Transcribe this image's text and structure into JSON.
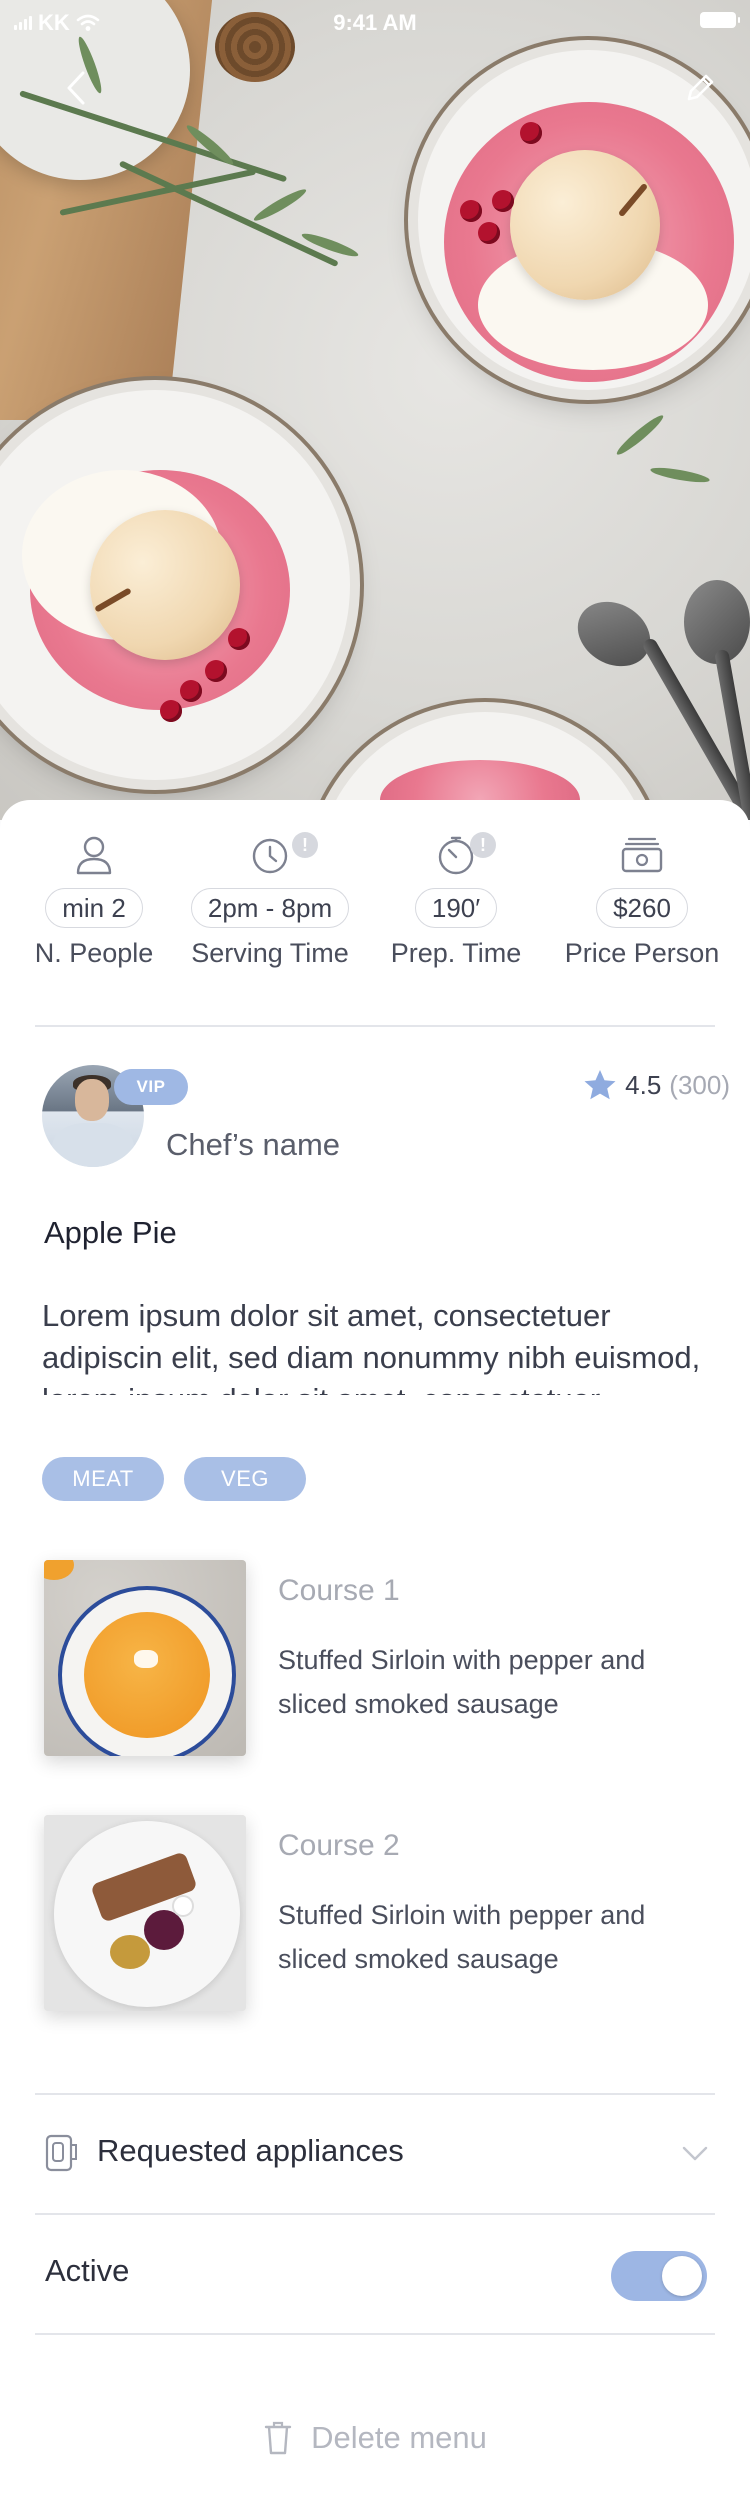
{
  "status_bar": {
    "carrier": "KK",
    "time": "9:41 AM"
  },
  "stats": [
    {
      "value": "min 2",
      "label": "N. People",
      "icon": "person-icon",
      "alert": ""
    },
    {
      "value": "2pm - 8pm",
      "label": "Serving Time",
      "icon": "clock-icon",
      "alert": "!"
    },
    {
      "value": "190′",
      "label": "Prep. Time",
      "icon": "timer-icon",
      "alert": "!"
    },
    {
      "value": "$260",
      "label": "Price Person",
      "icon": "money-icon",
      "alert": ""
    }
  ],
  "chef": {
    "badge": "VIP",
    "name": "Chef’s name",
    "rating": "4.5",
    "reviews": "(300)"
  },
  "dish": {
    "title": "Apple Pie",
    "description": "Lorem ipsum dolor sit amet, consectetuer adipiscin elit, sed diam nonummy nibh euismod, lorem ipsum dolor sit amet, consectetuer"
  },
  "tags": [
    "MEAT",
    "VEG"
  ],
  "courses": [
    {
      "title": "Course 1",
      "description": "Stuffed Sirloin with pepper and sliced smoked sausage"
    },
    {
      "title": "Course 2",
      "description": "Stuffed Sirloin with pepper and sliced smoked sausage"
    }
  ],
  "appliances": {
    "label": "Requested appliances"
  },
  "active": {
    "label": "Active",
    "on": true
  },
  "delete": {
    "label": "Delete menu"
  },
  "colors": {
    "accent": "#9db6e4",
    "tag": "#a9bfe6",
    "divider": "#e3e5ea"
  }
}
